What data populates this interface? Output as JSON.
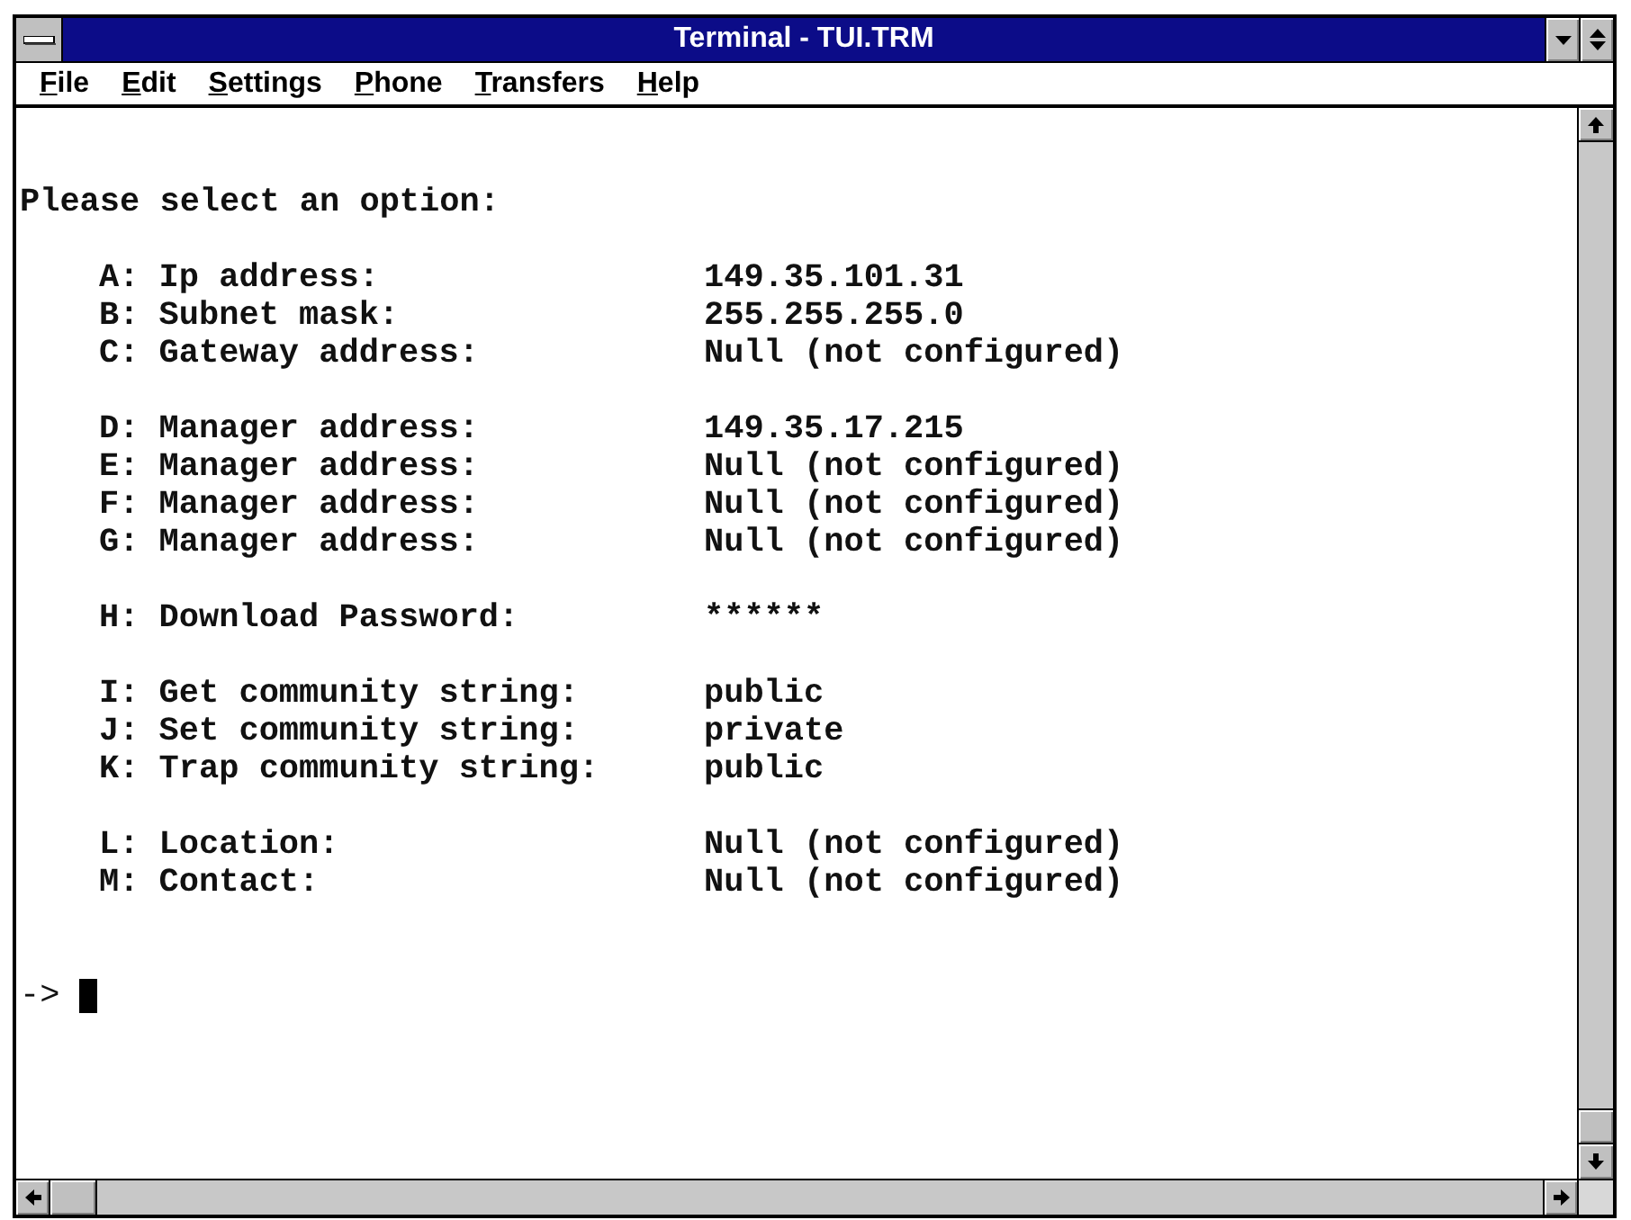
{
  "window": {
    "title": "Terminal - TUI.TRM"
  },
  "menu": [
    "File",
    "Edit",
    "Settings",
    "Phone",
    "Transfers",
    "Help"
  ],
  "terminal": {
    "heading": "Please select an option:",
    "option_groups": [
      {
        "options": [
          {
            "label": "A: Ip address:",
            "value": "149.35.101.31"
          },
          {
            "label": "B: Subnet mask:",
            "value": "255.255.255.0"
          },
          {
            "label": "C: Gateway address:",
            "value": "Null (not configured)"
          }
        ]
      },
      {
        "options": [
          {
            "label": "D: Manager address:",
            "value": "149.35.17.215"
          },
          {
            "label": "E: Manager address:",
            "value": "Null (not configured)"
          },
          {
            "label": "F: Manager address:",
            "value": "Null (not configured)"
          },
          {
            "label": "G: Manager address:",
            "value": "Null (not configured)"
          }
        ]
      },
      {
        "options": [
          {
            "label": "H: Download Password:",
            "value": "******"
          }
        ]
      },
      {
        "options": [
          {
            "label": "I: Get community string:",
            "value": "public"
          },
          {
            "label": "J: Set community string:",
            "value": "private"
          },
          {
            "label": "K: Trap community string:",
            "value": "public"
          }
        ]
      },
      {
        "options": [
          {
            "label": "L: Location:",
            "value": "Null (not configured)"
          },
          {
            "label": "M: Contact:",
            "value": "Null (not configured)"
          }
        ]
      }
    ],
    "prompt": "->"
  }
}
